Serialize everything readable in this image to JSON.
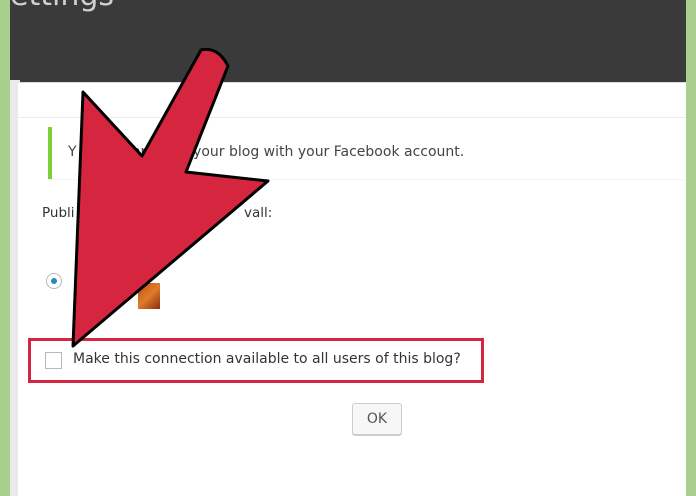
{
  "background": {
    "title_fragment": "ettings"
  },
  "dialog": {
    "notice_text": "Y        fully connected your blog with your Facebook account.",
    "publish_label": "Publi",
    "publish_suffix": "vall:",
    "checkbox_label": "Make this connection available to all users of this blog?",
    "checkbox_checked": false,
    "radio_selected": true,
    "ok_label": "OK"
  },
  "colors": {
    "arrow_red": "#d6263f",
    "notice_green": "#7ad03a",
    "radio_blue": "#1e8cbe",
    "frame_green": "#a9cf8f"
  },
  "icons": {
    "pointer": "red-arrow-icon",
    "avatar": "facebook-avatar"
  }
}
